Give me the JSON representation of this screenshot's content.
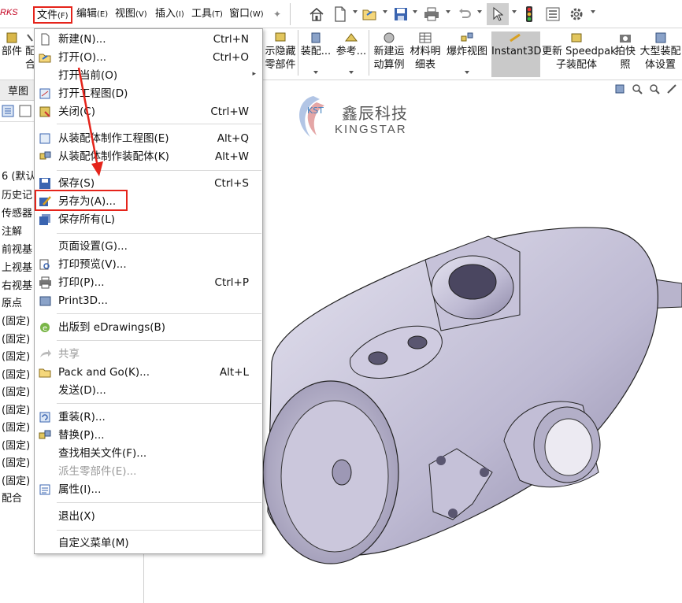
{
  "app": {
    "brand": "RKS"
  },
  "menubar": {
    "file": "文件",
    "file_key": "(F)",
    "edit": "编辑",
    "edit_key": "(E)",
    "view": "视图",
    "view_key": "(V)",
    "insert": "插入",
    "insert_key": "(I)",
    "tools": "工具",
    "tools_key": "(T)",
    "window": "窗口",
    "window_key": "(W)"
  },
  "toolbar_icons": [
    "home-icon",
    "new-document-icon",
    "open-folder-icon",
    "save-icon",
    "print-icon",
    "undo-icon",
    "select-cursor-icon",
    "traffic-light-icon",
    "list-icon",
    "gear-icon"
  ],
  "cmdbar": {
    "items": [
      {
        "line1": "部件",
        "line2": ""
      },
      {
        "line1": "配",
        "line2": "合"
      },
      {
        "line1": "示隐藏",
        "line2": "零部件"
      },
      {
        "line1": "装配...",
        "line2": ""
      },
      {
        "line1": "参考...",
        "line2": ""
      },
      {
        "line1": "新建运",
        "line2": "动算例"
      },
      {
        "line1": "材料明",
        "line2": "细表"
      },
      {
        "line1": "爆炸视图",
        "line2": ""
      },
      {
        "line1": "Instant3D",
        "line2": ""
      },
      {
        "line1": "更新 Speedpak",
        "line2": "子装配体"
      },
      {
        "line1": "拍快",
        "line2": "照"
      },
      {
        "line1": "大型装配",
        "line2": "体设置"
      }
    ]
  },
  "leftpanel": {
    "tab": "草图",
    "tree": [
      "6 (默认",
      "历史记",
      "传感器",
      "注解",
      "前视基",
      "上视基",
      "右视基",
      "原点",
      "(固定)",
      "(固定)",
      "(固定)",
      "(固定)",
      "(固定)",
      "(固定)",
      "(固定)",
      "(固定)",
      "(固定)",
      "(固定)",
      "配合"
    ]
  },
  "logo": {
    "kst": "KST",
    "name_cn": "鑫辰科技",
    "name_en": "KINGSTAR"
  },
  "file_menu": {
    "items": [
      {
        "label": "新建(N)...",
        "shortcut": "Ctrl+N",
        "icon": "new-document-icon",
        "disabled": false
      },
      {
        "label": "打开(O)...",
        "shortcut": "Ctrl+O",
        "icon": "open-folder-icon",
        "disabled": false
      },
      {
        "label": "打开当前(O)",
        "shortcut": "",
        "icon": "",
        "disabled": false
      },
      {
        "label": "打开工程图(D)",
        "shortcut": "",
        "icon": "drawing-icon",
        "disabled": false
      },
      {
        "label": "关闭(C)",
        "shortcut": "Ctrl+W",
        "icon": "close-document-icon",
        "disabled": false
      },
      {
        "label": "从装配体制作工程图(E)",
        "shortcut": "Alt+Q",
        "icon": "make-drawing-icon",
        "disabled": false
      },
      {
        "label": "从装配体制作装配体(K)",
        "shortcut": "Alt+W",
        "icon": "make-assembly-icon",
        "disabled": false
      },
      {
        "label": "保存(S)",
        "shortcut": "Ctrl+S",
        "icon": "save-icon",
        "disabled": false
      },
      {
        "label": "另存为(A)...",
        "shortcut": "",
        "icon": "save-as-icon",
        "disabled": false
      },
      {
        "label": "保存所有(L)",
        "shortcut": "",
        "icon": "save-all-icon",
        "disabled": false
      },
      {
        "label": "页面设置(G)...",
        "shortcut": "",
        "icon": "",
        "disabled": false
      },
      {
        "label": "打印预览(V)...",
        "shortcut": "",
        "icon": "print-preview-icon",
        "disabled": false
      },
      {
        "label": "打印(P)...",
        "shortcut": "Ctrl+P",
        "icon": "print-icon",
        "disabled": false
      },
      {
        "label": "Print3D...",
        "shortcut": "",
        "icon": "print3d-icon",
        "disabled": false
      },
      {
        "label": "出版到 eDrawings(B)",
        "shortcut": "",
        "icon": "edrawings-icon",
        "disabled": false
      },
      {
        "label": "共享",
        "shortcut": "",
        "icon": "share-icon",
        "disabled": true
      },
      {
        "label": "Pack and Go(K)...",
        "shortcut": "Alt+L",
        "icon": "pack-and-go-icon",
        "disabled": false
      },
      {
        "label": "发送(D)...",
        "shortcut": "",
        "icon": "",
        "disabled": false
      },
      {
        "label": "重装(R)...",
        "shortcut": "",
        "icon": "reload-icon",
        "disabled": false
      },
      {
        "label": "替换(P)...",
        "shortcut": "",
        "icon": "replace-icon",
        "disabled": false
      },
      {
        "label": "查找相关文件(F)...",
        "shortcut": "",
        "icon": "",
        "disabled": false
      },
      {
        "label": "派生零部件(E)...",
        "shortcut": "",
        "icon": "",
        "disabled": true
      },
      {
        "label": "属性(I)...",
        "shortcut": "",
        "icon": "properties-icon",
        "disabled": false
      },
      {
        "label": "退出(X)",
        "shortcut": "",
        "icon": "",
        "disabled": false
      },
      {
        "label": "自定义菜单(M)",
        "shortcut": "",
        "icon": "",
        "disabled": false
      }
    ]
  },
  "colors": {
    "highlight": "#e5241b",
    "model": "#c9c6dc",
    "brand": "#c3001f"
  }
}
